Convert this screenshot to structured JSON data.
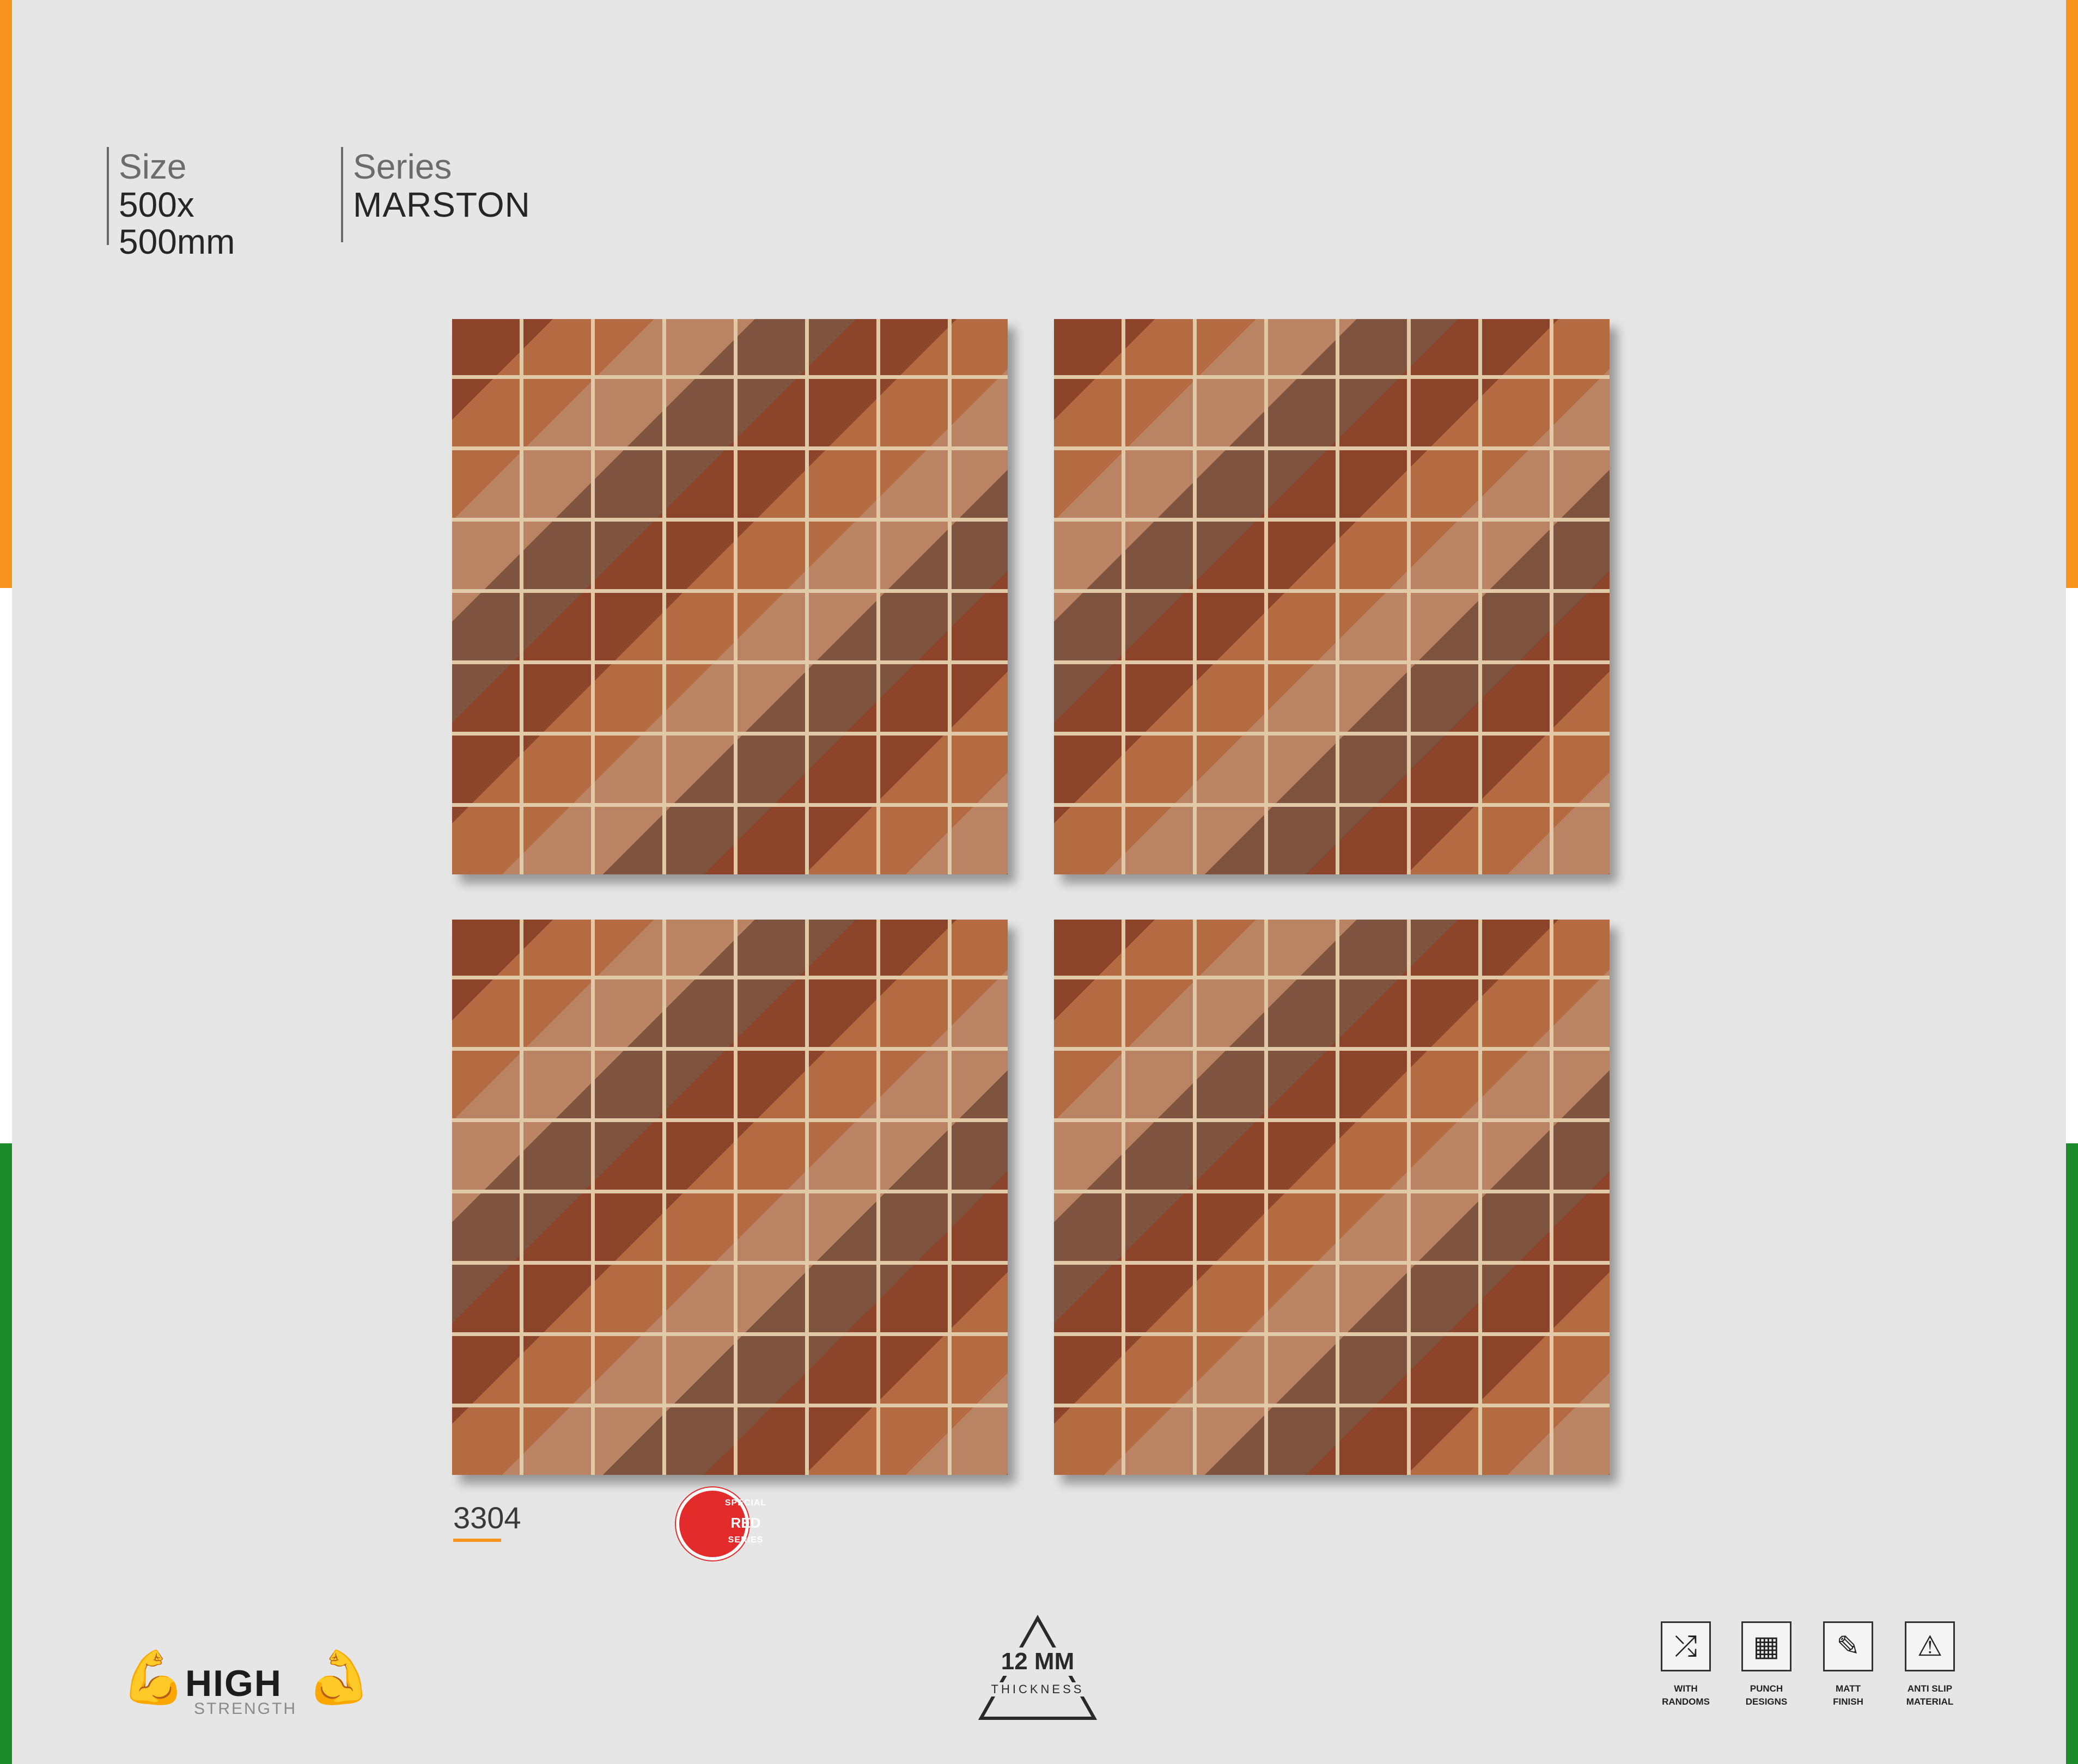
{
  "spec": {
    "size_label": "Size",
    "size_line1": "500x",
    "size_line2": "500mm",
    "series_label": "Series",
    "series_value": "MARSTON"
  },
  "product": {
    "code": "3304"
  },
  "badge": {
    "top": "SPECIAL",
    "middle": "RED",
    "bottom": "SERIES"
  },
  "strength_logo": {
    "word1": "HIGH",
    "word2": "STRENGTH"
  },
  "thickness": {
    "value": "12 MM",
    "label": "THICKNESS"
  },
  "features": [
    {
      "icon": "shuffle-icon",
      "line1": "WITH",
      "line2": "RANDOMS"
    },
    {
      "icon": "grid-icon",
      "line1": "PUNCH",
      "line2": "DESIGNS"
    },
    {
      "icon": "feather-icon",
      "line1": "MATT",
      "line2": "FINISH"
    },
    {
      "icon": "slip-icon",
      "line1": "ANTI SLIP",
      "line2": "MATERIAL"
    }
  ],
  "colors": {
    "orange": "#f7941d",
    "white": "#ffffff",
    "green": "#1d8a2b",
    "badge_red": "#e32b2b",
    "background": "#e6e6e6"
  }
}
